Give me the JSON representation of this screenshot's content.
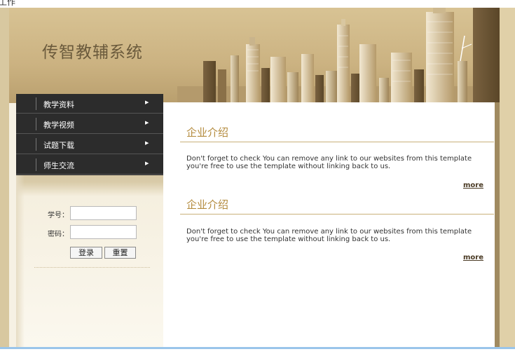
{
  "window": {
    "title_fragment": "工作"
  },
  "header": {
    "site_title": "传智教辅系统"
  },
  "nav": {
    "items": [
      {
        "label": "教学资料"
      },
      {
        "label": "教学视频"
      },
      {
        "label": "试题下载"
      },
      {
        "label": "师生交流"
      }
    ]
  },
  "login": {
    "student_id_label": "学号：",
    "password_label": "密码：",
    "student_id_value": "",
    "password_value": "",
    "login_button": "登录",
    "reset_button": "重置"
  },
  "sections": [
    {
      "title": "企业介绍",
      "text": "Don't forget to check You can remove any link to our websites from this template you're free to use the template without linking back to us.",
      "more": "more"
    },
    {
      "title": "企业介绍",
      "text": "Don't forget to check You can remove any link to our websites from this template you're free to use the template without linking back to us.",
      "more": "more"
    }
  ],
  "colors": {
    "nav_background": "#2c2c2c",
    "accent_title": "#b38a3c",
    "header_tone": "#cbb281"
  }
}
